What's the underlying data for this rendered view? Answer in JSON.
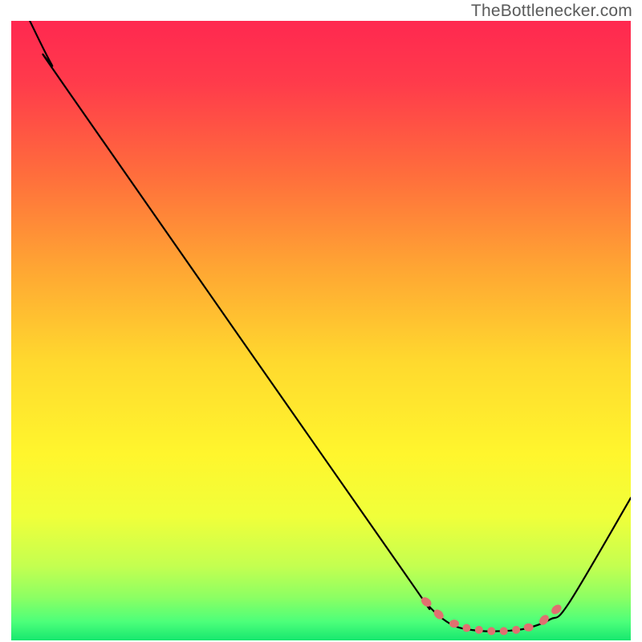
{
  "watermark": "TheBottlenecker.com",
  "chart_data": {
    "type": "line",
    "title": "",
    "xlabel": "",
    "ylabel": "",
    "xlim": [
      0,
      100
    ],
    "ylim": [
      0,
      100
    ],
    "grid": false,
    "legend": false,
    "gradient_stops": [
      {
        "offset": 0.0,
        "color": "#ff2850"
      },
      {
        "offset": 0.1,
        "color": "#ff3b4b"
      },
      {
        "offset": 0.25,
        "color": "#ff6e3c"
      },
      {
        "offset": 0.4,
        "color": "#ffa633"
      },
      {
        "offset": 0.55,
        "color": "#ffd92e"
      },
      {
        "offset": 0.7,
        "color": "#fff62d"
      },
      {
        "offset": 0.8,
        "color": "#f0ff3a"
      },
      {
        "offset": 0.88,
        "color": "#c4ff50"
      },
      {
        "offset": 0.93,
        "color": "#8dff63"
      },
      {
        "offset": 0.97,
        "color": "#4cff7a"
      },
      {
        "offset": 1.0,
        "color": "#17e86f"
      }
    ],
    "series": [
      {
        "name": "curve",
        "stroke": "#000000",
        "stroke_width": 2.2,
        "points": [
          {
            "x": 3.0,
            "y": 100.0
          },
          {
            "x": 6.5,
            "y": 93.0
          },
          {
            "x": 10.0,
            "y": 87.5
          },
          {
            "x": 62.0,
            "y": 13.0
          },
          {
            "x": 67.0,
            "y": 6.0
          },
          {
            "x": 71.0,
            "y": 2.6
          },
          {
            "x": 75.0,
            "y": 1.6
          },
          {
            "x": 79.0,
            "y": 1.5
          },
          {
            "x": 83.0,
            "y": 1.9
          },
          {
            "x": 87.0,
            "y": 3.4
          },
          {
            "x": 90.0,
            "y": 6.0
          },
          {
            "x": 100.0,
            "y": 23.0
          }
        ]
      }
    ],
    "markers": {
      "name": "well-markers",
      "fill": "#e07070",
      "stroke": "#c85e5e",
      "points": [
        {
          "x": 67.0,
          "y": 6.2,
          "rx": 5,
          "ry": 7,
          "rot": -50
        },
        {
          "x": 69.0,
          "y": 4.2,
          "rx": 5,
          "ry": 7,
          "rot": -45
        },
        {
          "x": 71.5,
          "y": 2.7,
          "rx": 6,
          "ry": 5,
          "rot": 0
        },
        {
          "x": 73.5,
          "y": 2.0,
          "rx": 5,
          "ry": 5,
          "rot": 0
        },
        {
          "x": 75.5,
          "y": 1.7,
          "rx": 5,
          "ry": 5,
          "rot": 0
        },
        {
          "x": 77.5,
          "y": 1.5,
          "rx": 5,
          "ry": 5,
          "rot": 0
        },
        {
          "x": 79.5,
          "y": 1.5,
          "rx": 5,
          "ry": 5,
          "rot": 0
        },
        {
          "x": 81.5,
          "y": 1.7,
          "rx": 5,
          "ry": 5,
          "rot": 0
        },
        {
          "x": 83.5,
          "y": 2.1,
          "rx": 6,
          "ry": 5,
          "rot": 0
        },
        {
          "x": 86.0,
          "y": 3.3,
          "rx": 5,
          "ry": 7,
          "rot": 40
        },
        {
          "x": 88.0,
          "y": 5.0,
          "rx": 5,
          "ry": 7,
          "rot": 50
        }
      ]
    }
  }
}
